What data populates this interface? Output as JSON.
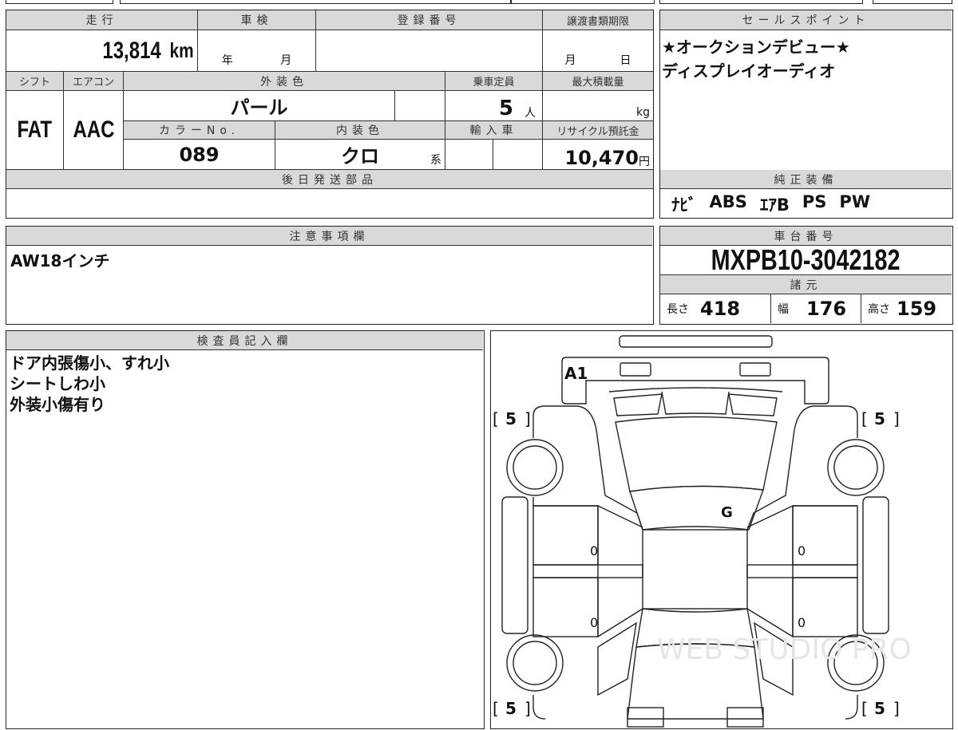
{
  "vehicle": {
    "mileage_label": "走行",
    "mileage": "13,814",
    "mileage_unit": "km",
    "shaken_label": "車検",
    "shaken_year_unit": "年",
    "shaken_month_unit": "月",
    "registration_label": "登録番号",
    "registration": "",
    "transfer_deadline_label": "譲渡書類期限",
    "transfer_month_unit": "月",
    "transfer_day_unit": "日",
    "shift_label": "シフト",
    "shift": "FAT",
    "aircon_label": "エアコン",
    "aircon": "AAC",
    "exterior_color_label": "外装色",
    "exterior_color": "パール",
    "capacity_label": "乗車定員",
    "capacity": "5",
    "capacity_unit": "人",
    "max_load_label": "最大積載量",
    "max_load_unit": "kg",
    "color_no_label": "カラーNo.",
    "color_no": "089",
    "interior_color_label": "内装色",
    "interior_color": "クロ",
    "interior_color_suffix": "系",
    "import_label": "輸入車",
    "recycle_label": "リサイクル預託金",
    "recycle_fee": "10,470",
    "recycle_unit": "円",
    "later_parts_label": "後日発送部品",
    "later_parts": ""
  },
  "sales_point": {
    "label": "セールスポイント",
    "lines": [
      "★オークションデビュー★",
      "ディスプレイオーディオ"
    ]
  },
  "equipment": {
    "label": "純正装備",
    "items": [
      "ﾅﾋﾞ",
      "ABS",
      "ｴｱB",
      "PS",
      "PW"
    ]
  },
  "notes": {
    "label": "注意事項欄",
    "text": "AW18インチ"
  },
  "chassis": {
    "label": "車台番号",
    "number": "MXPB10-3042182",
    "specs_label": "諸元",
    "length_label": "長さ",
    "length": "418",
    "width_label": "幅",
    "width": "176",
    "height_label": "高さ",
    "height": "159"
  },
  "inspector": {
    "label": "検査員記入欄",
    "lines": [
      "ドア内張傷小、すれ小",
      "シートしわ小",
      "外装小傷有り"
    ]
  },
  "diagram": {
    "rear_mark": "A1",
    "roof_mark": "G",
    "tire_tread": [
      "5",
      "5",
      "5",
      "5"
    ],
    "door_marks": [
      "0",
      "0",
      "0",
      "0"
    ],
    "watermark": "WEB STUDIO PRO"
  }
}
